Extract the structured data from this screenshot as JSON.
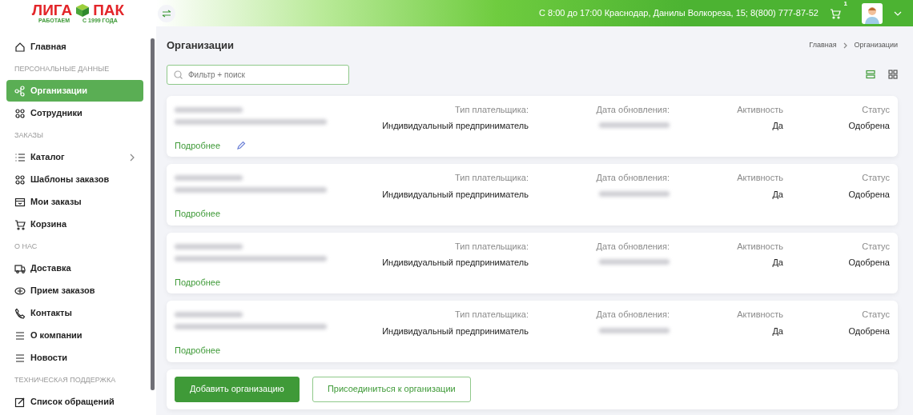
{
  "logo": {
    "name_left": "ЛИГА",
    "name_right": "ПАК",
    "tagline_left": "РАБОТАЕМ",
    "tagline_right": "С 1999 ГОДА"
  },
  "header": {
    "contact": "С 8:00 до 17:00 Краснодар, Данилы Волкореза, 15; 8(800) 777-87-52",
    "cart_count": "1"
  },
  "sidebar": {
    "items": [
      {
        "kind": "item",
        "label": "Главная",
        "selected": false
      },
      {
        "kind": "section",
        "label": "ПЕРСОНАЛЬНЫЕ ДАННЫЕ"
      },
      {
        "kind": "item",
        "label": "Организации",
        "selected": true
      },
      {
        "kind": "item",
        "label": "Сотрудники",
        "selected": false
      },
      {
        "kind": "section",
        "label": "ЗАКАЗЫ"
      },
      {
        "kind": "submenu",
        "label": "Каталог",
        "selected": false
      },
      {
        "kind": "item",
        "label": "Шаблоны заказов",
        "selected": false
      },
      {
        "kind": "item",
        "label": "Мои заказы",
        "selected": false
      },
      {
        "kind": "item",
        "label": "Корзина",
        "selected": false
      },
      {
        "kind": "section",
        "label": "О НАС"
      },
      {
        "kind": "item",
        "label": "Доставка",
        "selected": false
      },
      {
        "kind": "item",
        "label": "Прием заказов",
        "selected": false
      },
      {
        "kind": "item",
        "label": "Контакты",
        "selected": false
      },
      {
        "kind": "item",
        "label": "О компании",
        "selected": false
      },
      {
        "kind": "item",
        "label": "Новости",
        "selected": false
      },
      {
        "kind": "section",
        "label": "ТЕХНИЧЕСКАЯ ПОДДЕРЖКА"
      },
      {
        "kind": "item",
        "label": "Список обращений",
        "selected": false
      }
    ]
  },
  "page": {
    "title": "Организации",
    "breadcrumbs": [
      "Главная",
      "Организации"
    ],
    "search": {
      "placeholder": "Фильтр + поиск"
    },
    "view_modes": [
      {
        "kind": "list",
        "selected": true
      },
      {
        "kind": "grid",
        "selected": false
      }
    ]
  },
  "organizations": [
    {
      "payer_label": "Тип плательщика:",
      "payer": "Индивидуальный предприниматель",
      "date_label": "Дата обновления:",
      "activity_label": "Активность",
      "activity": "Да",
      "status_label": "Статус",
      "status": "Одобрена",
      "details": "Подробнее",
      "editable": true
    },
    {
      "payer_label": "Тип плательщика:",
      "payer": "Индивидуальный предприниматель",
      "date_label": "Дата обновления:",
      "activity_label": "Активность",
      "activity": "Да",
      "status_label": "Статус",
      "status": "Одобрена",
      "details": "Подробнее",
      "editable": false
    },
    {
      "payer_label": "Тип плательщика:",
      "payer": "Индивидуальный предприниматель",
      "date_label": "Дата обновления:",
      "activity_label": "Активность",
      "activity": "Да",
      "status_label": "Статус",
      "status": "Одобрена",
      "details": "Подробнее",
      "editable": false
    },
    {
      "payer_label": "Тип плательщика:",
      "payer": "Индивидуальный предприниматель",
      "date_label": "Дата обновления:",
      "activity_label": "Активность",
      "activity": "Да",
      "status_label": "Статус",
      "status": "Одобрена",
      "details": "Подробнее",
      "editable": false
    }
  ],
  "actions": [
    {
      "kind": "primary",
      "label": "Добавить организацию"
    },
    {
      "kind": "outline",
      "label": "Присоединиться к организации"
    }
  ]
}
